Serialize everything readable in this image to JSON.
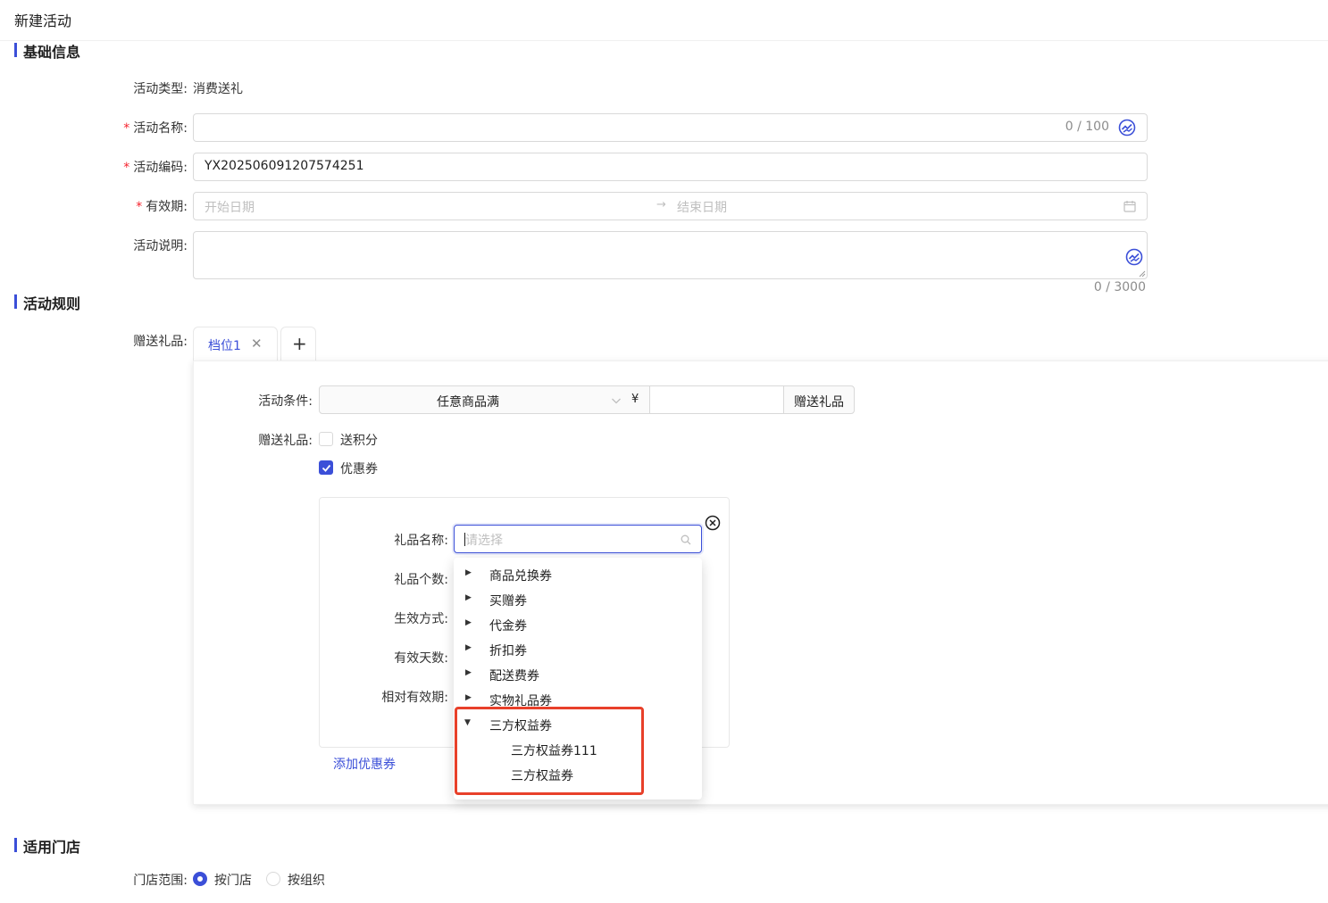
{
  "page": {
    "title": "新建活动"
  },
  "sections": {
    "basic": "基础信息",
    "rules": "活动规则",
    "stores": "适用门店"
  },
  "basic": {
    "type_label": "活动类型:",
    "type_value": "消费送礼",
    "name_label": "活动名称:",
    "name_counter": "0 / 100",
    "code_label": "活动编码:",
    "code_value": "YX202506091207574251",
    "period_label": "有效期:",
    "period_start_placeholder": "开始日期",
    "period_end_placeholder": "结束日期",
    "desc_label": "活动说明:",
    "desc_counter": "0 / 3000"
  },
  "rules": {
    "gift_label": "赠送礼品:",
    "tabs": [
      {
        "label": "档位1"
      }
    ],
    "add_tab": "+",
    "condition_label": "活动条件:",
    "condition_select": "任意商品满",
    "currency": "¥",
    "condition_suffix": "赠送礼品",
    "gift_type_label": "赠送礼品:",
    "points_label": "送积分",
    "points_checked": false,
    "coupon_label": "优惠券",
    "coupon_checked": true,
    "coupon_card": {
      "name_label": "礼品名称:",
      "name_placeholder": "请选择",
      "count_label": "礼品个数:",
      "effect_label": "生效方式:",
      "days_label": "有效天数:",
      "relative_label": "相对有效期:"
    },
    "add_coupon": "添加优惠券",
    "dropdown": {
      "items": [
        {
          "label": "商品兑换券",
          "expanded": false
        },
        {
          "label": "买赠券",
          "expanded": false
        },
        {
          "label": "代金券",
          "expanded": false
        },
        {
          "label": "折扣券",
          "expanded": false
        },
        {
          "label": "配送费券",
          "expanded": false
        },
        {
          "label": "实物礼品券",
          "expanded": false
        },
        {
          "label": "三方权益券",
          "expanded": true
        }
      ],
      "children": [
        {
          "label": "三方权益券111"
        },
        {
          "label": "三方权益券"
        }
      ]
    }
  },
  "stores": {
    "scope_label": "门店范围:",
    "options": [
      {
        "label": "按门店",
        "selected": true
      },
      {
        "label": "按组织",
        "selected": false
      }
    ]
  },
  "colors": {
    "accent": "#3b4fd8",
    "required": "#f5222d",
    "highlight": "#e8402a"
  }
}
